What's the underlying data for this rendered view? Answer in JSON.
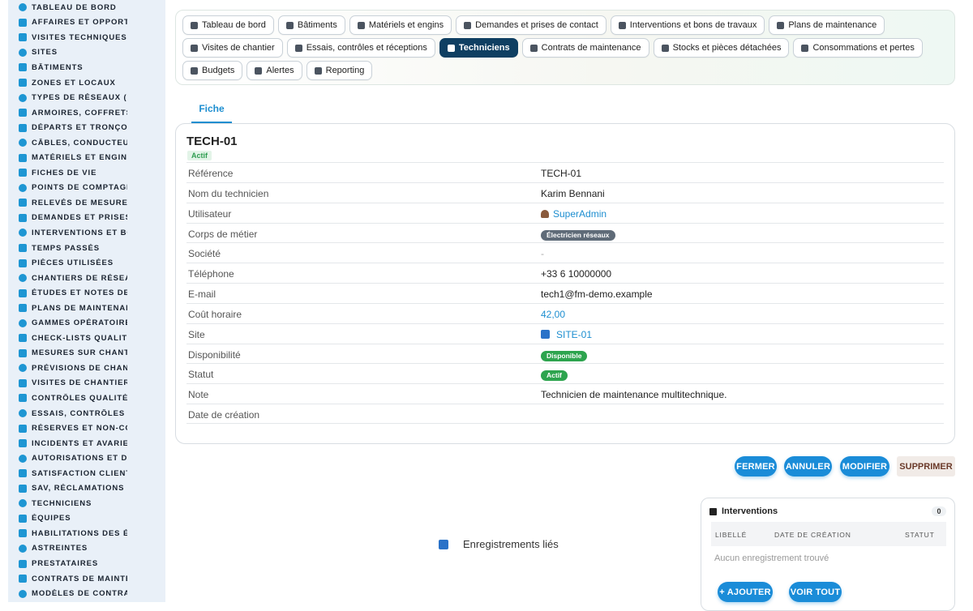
{
  "sidebar": {
    "items": [
      {
        "label": "Tableau de bord",
        "icon": "dashboard-icon"
      },
      {
        "label": "Affaires et opportunités",
        "icon": "target-icon"
      },
      {
        "label": "Visites techniques et études",
        "icon": "clipboard-icon"
      },
      {
        "label": "Sites",
        "icon": "pin-icon"
      },
      {
        "label": "Bâtiments",
        "icon": "building-icon"
      },
      {
        "label": "Zones et locaux",
        "icon": "grid-icon"
      },
      {
        "label": "Types de réseaux (BT / HTA)",
        "icon": "network-icon"
      },
      {
        "label": "Armoires, coffrets et tableaux",
        "icon": "cabinet-icon"
      },
      {
        "label": "Départs et tronçons",
        "icon": "branch-icon"
      },
      {
        "label": "Câbles, conducteurs",
        "icon": "cable-icon"
      },
      {
        "label": "Matériels et engins",
        "icon": "gears-icon"
      },
      {
        "label": "Fiches de vie",
        "icon": "history-icon"
      },
      {
        "label": "Points de comptage et mesure",
        "icon": "gauge-icon"
      },
      {
        "label": "Relevés de mesures",
        "icon": "chart-icon"
      },
      {
        "label": "Demandes et prises de contact",
        "icon": "question-icon"
      },
      {
        "label": "Interventions et bons de travaux",
        "icon": "clipboard-check-icon"
      },
      {
        "label": "Temps passés",
        "icon": "clock-icon"
      },
      {
        "label": "Pièces utilisées",
        "icon": "box-icon"
      },
      {
        "label": "Chantiers de réseaux",
        "icon": "hammer-icon"
      },
      {
        "label": "Études et notes de calcul",
        "icon": "drafting-icon"
      },
      {
        "label": "Plans de maintenance",
        "icon": "calendar-icon"
      },
      {
        "label": "Gammes opératoires",
        "icon": "list-icon"
      },
      {
        "label": "Check-lists qualité",
        "icon": "checklist-icon"
      },
      {
        "label": "Mesures sur chantier",
        "icon": "thermometer-icon"
      },
      {
        "label": "Prévisions de chantier",
        "icon": "trend-icon"
      },
      {
        "label": "Visites de chantier",
        "icon": "route-icon"
      },
      {
        "label": "Contrôles qualité",
        "icon": "search-icon"
      },
      {
        "label": "Essais, contrôles et réceptions",
        "icon": "file-check-icon"
      },
      {
        "label": "Réserves et non-conformités",
        "icon": "alert-circle-icon"
      },
      {
        "label": "Incidents et avaries",
        "icon": "warning-icon"
      },
      {
        "label": "Autorisations et DICT",
        "icon": "signature-icon"
      },
      {
        "label": "Satisfaction client",
        "icon": "smile-icon"
      },
      {
        "label": "SAV, réclamations et litiges",
        "icon": "chat-icon"
      },
      {
        "label": "Techniciens",
        "icon": "hardhat-icon"
      },
      {
        "label": "Équipes",
        "icon": "users-icon"
      },
      {
        "label": "Habilitations des équipes",
        "icon": "badge-icon"
      },
      {
        "label": "Astreintes",
        "icon": "phone-icon"
      },
      {
        "label": "Prestataires",
        "icon": "handshake-icon"
      },
      {
        "label": "Contrats de maintenance",
        "icon": "contract-icon"
      },
      {
        "label": "Modèles de contrats",
        "icon": "template-icon"
      }
    ]
  },
  "tabs": [
    {
      "label": "Tableau de bord",
      "icon": "dashboard-icon"
    },
    {
      "label": "Bâtiments",
      "icon": "building-icon"
    },
    {
      "label": "Matériels et engins",
      "icon": "gears-icon"
    },
    {
      "label": "Demandes et prises de contact",
      "icon": "question-icon"
    },
    {
      "label": "Interventions et bons de travaux",
      "icon": "clipboard-check-icon"
    },
    {
      "label": "Plans de maintenance",
      "icon": "calendar-icon"
    },
    {
      "label": "Visites de chantier",
      "icon": "route-icon"
    },
    {
      "label": "Essais, contrôles et réceptions",
      "icon": "file-check-icon"
    },
    {
      "label": "Techniciens",
      "icon": "hardhat-icon",
      "active": true
    },
    {
      "label": "Contrats de maintenance",
      "icon": "contract-icon"
    },
    {
      "label": "Stocks et pièces détachées",
      "icon": "stock-icon"
    },
    {
      "label": "Consommations et pertes",
      "icon": "bolt-icon"
    },
    {
      "label": "Budgets",
      "icon": "money-icon"
    },
    {
      "label": "Alertes",
      "icon": "bell-icon"
    },
    {
      "label": "Reporting",
      "icon": "pie-icon"
    }
  ],
  "subtab": "Fiche",
  "record": {
    "title": "TECH-01",
    "badge": "Actif",
    "fields": {
      "reference": {
        "label": "Référence",
        "value": "TECH-01"
      },
      "name": {
        "label": "Nom du technicien",
        "value": "Karim Bennani"
      },
      "user": {
        "label": "Utilisateur",
        "value": "SuperAdmin"
      },
      "trade": {
        "label": "Corps de métier",
        "value": "Électricien réseaux"
      },
      "company": {
        "label": "Société",
        "value": "-"
      },
      "phone": {
        "label": "Téléphone",
        "value": "+33 6 10000000"
      },
      "email": {
        "label": "E-mail",
        "value": "tech1@fm-demo.example"
      },
      "rate": {
        "label": "Coût horaire",
        "value": "42,00"
      },
      "site": {
        "label": "Site",
        "value": "SITE-01"
      },
      "availability": {
        "label": "Disponibilité",
        "value": "Disponible"
      },
      "status": {
        "label": "Statut",
        "value": "Actif"
      },
      "note": {
        "label": "Note",
        "value": "Technicien de maintenance multitechnique."
      },
      "created": {
        "label": "Date de création",
        "value": ""
      }
    }
  },
  "actions": {
    "close": "FERMER",
    "cancel": "ANNULER",
    "edit": "MODIFIER",
    "delete": "SUPPRIMER"
  },
  "related": {
    "label": "Enregistrements liés"
  },
  "interventions": {
    "title": "Interventions",
    "count": "0",
    "columns": [
      "Libellé",
      "Date de création",
      "Statut"
    ],
    "empty": "Aucun enregistrement trouvé",
    "add": "+ AJOUTER",
    "view_all": "VOIR TOUT"
  },
  "colors": {
    "accent": "#1a8cd8",
    "active_tab": "#0f3f62",
    "success": "#2da44e"
  }
}
